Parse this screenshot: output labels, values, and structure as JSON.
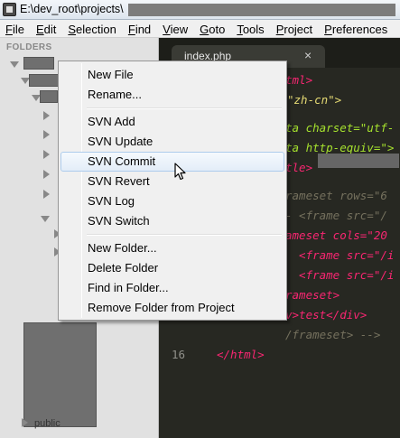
{
  "window": {
    "title": "E:\\dev_root\\projects\\"
  },
  "menubar": [
    {
      "name": "menu-file",
      "label": "File"
    },
    {
      "name": "menu-edit",
      "label": "Edit"
    },
    {
      "name": "menu-selection",
      "label": "Selection"
    },
    {
      "name": "menu-find",
      "label": "Find"
    },
    {
      "name": "menu-view",
      "label": "View"
    },
    {
      "name": "menu-goto",
      "label": "Goto"
    },
    {
      "name": "menu-tools",
      "label": "Tools"
    },
    {
      "name": "menu-project",
      "label": "Project"
    },
    {
      "name": "menu-preferences",
      "label": "Preferences"
    }
  ],
  "sidebar": {
    "header": "FOLDERS",
    "bottom_label": "public"
  },
  "editor": {
    "tab": {
      "label": "index.php",
      "close": "×"
    },
    "lines": [
      {
        "num": "",
        "text": "tml>"
      },
      {
        "num": "",
        "text": "\"zh-cn\">"
      },
      {
        "num": "",
        "text": "ta charset=\"utf-"
      },
      {
        "num": "",
        "text": "ta http-equiv=\">"
      },
      {
        "num": "",
        "text": "tle>"
      },
      {
        "num": "",
        "text": "rameset rows=\"6"
      },
      {
        "num": "",
        "text": "- <frame src=\"/"
      },
      {
        "num": "",
        "text": "ameset cols=\"20"
      },
      {
        "num": "",
        "text": "  <frame src=\"/i"
      },
      {
        "num": "",
        "text": "  <frame src=\"/i"
      },
      {
        "num": "",
        "text": "rameset>"
      },
      {
        "num": "",
        "text": "v>test</div>"
      },
      {
        "num": "",
        "text": "/frameset> -->"
      },
      {
        "num": "16",
        "text": "</html>"
      }
    ],
    "selected_word": "test"
  },
  "context_menu": {
    "items": [
      {
        "name": "ctx-new-file",
        "label": "New File"
      },
      {
        "name": "ctx-rename",
        "label": "Rename..."
      },
      {
        "name": "ctx-svn-add",
        "label": "SVN Add"
      },
      {
        "name": "ctx-svn-update",
        "label": "SVN Update"
      },
      {
        "name": "ctx-svn-commit",
        "label": "SVN Commit",
        "hover": true
      },
      {
        "name": "ctx-svn-revert",
        "label": "SVN Revert"
      },
      {
        "name": "ctx-svn-log",
        "label": "SVN Log"
      },
      {
        "name": "ctx-svn-switch",
        "label": "SVN Switch"
      },
      {
        "name": "ctx-new-folder",
        "label": "New Folder..."
      },
      {
        "name": "ctx-delete-folder",
        "label": "Delete Folder"
      },
      {
        "name": "ctx-find-in-folder",
        "label": "Find in Folder..."
      },
      {
        "name": "ctx-remove-folder",
        "label": "Remove Folder from Project"
      }
    ]
  },
  "colors": {
    "editor_bg": "#272822",
    "sidebar_bg": "#e1e1e1",
    "menu_bg": "#f0f0f0",
    "hover_border": "#aeccec"
  }
}
